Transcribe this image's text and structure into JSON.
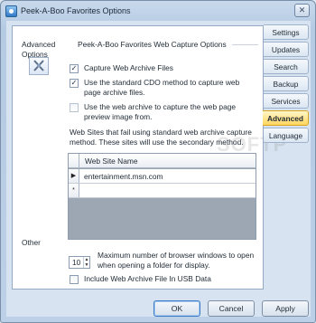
{
  "window": {
    "title": "Peek-A-Boo Favorites Options"
  },
  "tabs": [
    {
      "label": "Settings",
      "active": false
    },
    {
      "label": "Updates",
      "active": false
    },
    {
      "label": "Search",
      "active": false
    },
    {
      "label": "Backup",
      "active": false
    },
    {
      "label": "Services",
      "active": false
    },
    {
      "label": "Advanced",
      "active": true
    },
    {
      "label": "Language",
      "active": false
    }
  ],
  "advanced": {
    "section_label": "Advanced Options",
    "title": "Peek-A-Boo Favorites Web Capture Options",
    "options": [
      {
        "label": "Capture Web Archive Files",
        "checked": true,
        "enabled": true
      },
      {
        "label": "Use the standard CDO method to capture web page archive files.",
        "checked": true,
        "enabled": true
      },
      {
        "label": "Use the web archive to capture the web page preview image from.",
        "checked": false,
        "enabled": false
      }
    ],
    "note": "Web Sites that fail using standard web archive capture method. These sites will use the secondary method.",
    "grid": {
      "column": "Web Site Name",
      "rows": [
        {
          "marker": "▶",
          "value": "entertainment.msn.com"
        },
        {
          "marker": "*",
          "value": ""
        }
      ]
    }
  },
  "other": {
    "section_label": "Other",
    "max_windows": {
      "value": "10",
      "label": "Maximum number of browser windows to open when opening a folder for display."
    },
    "usb": {
      "label": "Include Web Archive File In USB Data",
      "checked": false
    }
  },
  "buttons": {
    "ok": "OK",
    "cancel": "Cancel",
    "apply": "Apply"
  },
  "watermark": "SOFTP",
  "colors": {
    "active_tab": "#ffd65e",
    "panel_bg": "#ffffff",
    "frame": "#bcd0e7"
  }
}
